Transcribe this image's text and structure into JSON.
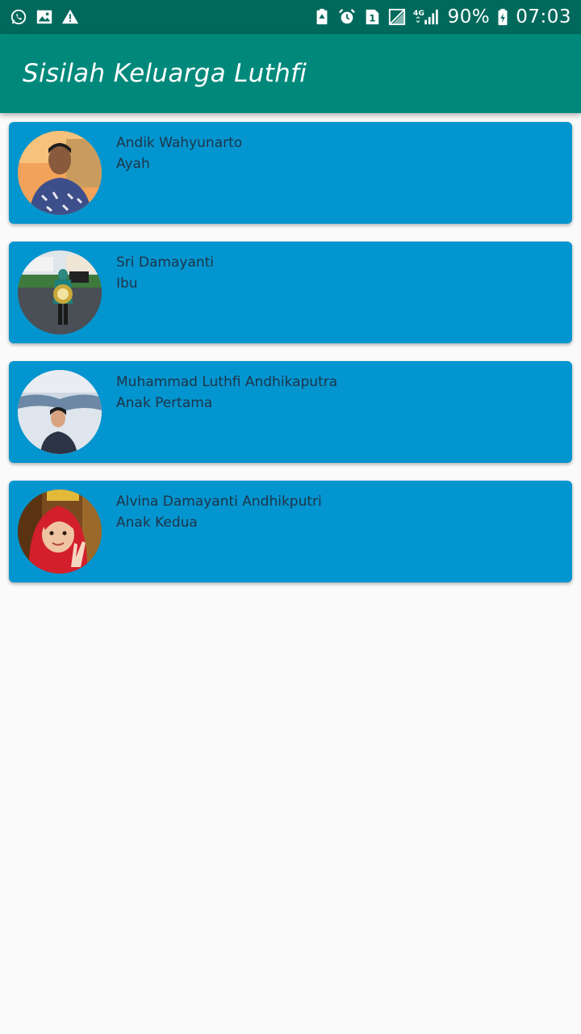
{
  "status_bar": {
    "left_icons": [
      "whatsapp-icon",
      "image-icon",
      "warning-icon"
    ],
    "right_icons": [
      "battery-saver-icon",
      "alarm-icon",
      "sim-1-icon",
      "no-signal-icon",
      "4g-signal-icon"
    ],
    "network_label": "4G",
    "sim_label": "1",
    "battery": "90%",
    "time": "07:03"
  },
  "app_bar": {
    "title": "Sisilah Keluarga Luthfi"
  },
  "colors": {
    "status_bar": "#00695c",
    "app_bar": "#00897b",
    "card": "#0395cf",
    "card_text": "#1f3448",
    "background": "#fafafa"
  },
  "family": [
    {
      "name": "Andik Wahyunarto",
      "role": "Ayah"
    },
    {
      "name": "Sri Damayanti",
      "role": "Ibu"
    },
    {
      "name": "Muhammad Luthfi Andhikaputra",
      "role": "Anak Pertama"
    },
    {
      "name": "Alvina Damayanti Andhikputri",
      "role": "Anak Kedua"
    }
  ]
}
